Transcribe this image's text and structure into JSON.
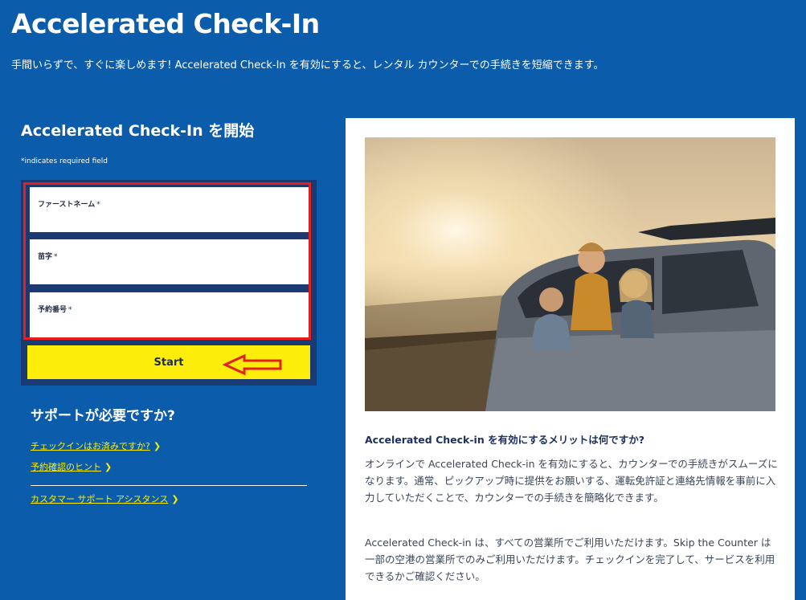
{
  "header": {
    "title": "Accelerated Check-In",
    "intro": "手間いらずで、すぐに楽しめます! Accelerated Check-In を有効にすると、レンタル カウンターでの手続きを短縮できます。"
  },
  "form": {
    "heading": "Accelerated Check-In を開始",
    "required_note": "*indicates required field",
    "fields": [
      {
        "label": "ファーストネーム",
        "required_mark": "*",
        "value": ""
      },
      {
        "label": "苗字",
        "required_mark": "*",
        "value": ""
      },
      {
        "label": "予約番号",
        "required_mark": "*",
        "value": ""
      }
    ],
    "start_label": "Start"
  },
  "support": {
    "heading": "サポートが必要ですか?",
    "links": [
      {
        "label": "チェックインはお済みですか?"
      },
      {
        "label": "予約確認のヒント"
      },
      {
        "label": "カスタマー サポート アシスタンス"
      }
    ]
  },
  "panel": {
    "benefit_heading": "Accelerated Check-in を有効にするメリットは何ですか?",
    "paragraph1": "オンラインで Accelerated Check-in を有効にすると、カウンターでの手続きがスムーズになります。通常、ピックアップ時に提供をお願いする、運転免許証と連絡先情報を事前に入力していただくことで、カウンターでの手続きを簡略化できます。",
    "paragraph2": "Accelerated Check-in は、すべての営業所でご利用いただけます。Skip the Counter は一部の空港の営業所でのみご利用いただけます。チェックインを完了して、サービスを利用できるかご確認ください。"
  },
  "colors": {
    "background": "#0b5caa",
    "form_box": "#1c3a72",
    "accent_yellow": "#fcee0a",
    "annotation_red": "#e3211d"
  },
  "icons": {
    "link_chevron": "chevron-right-icon",
    "annotation": "left-arrow-annotation-icon"
  }
}
